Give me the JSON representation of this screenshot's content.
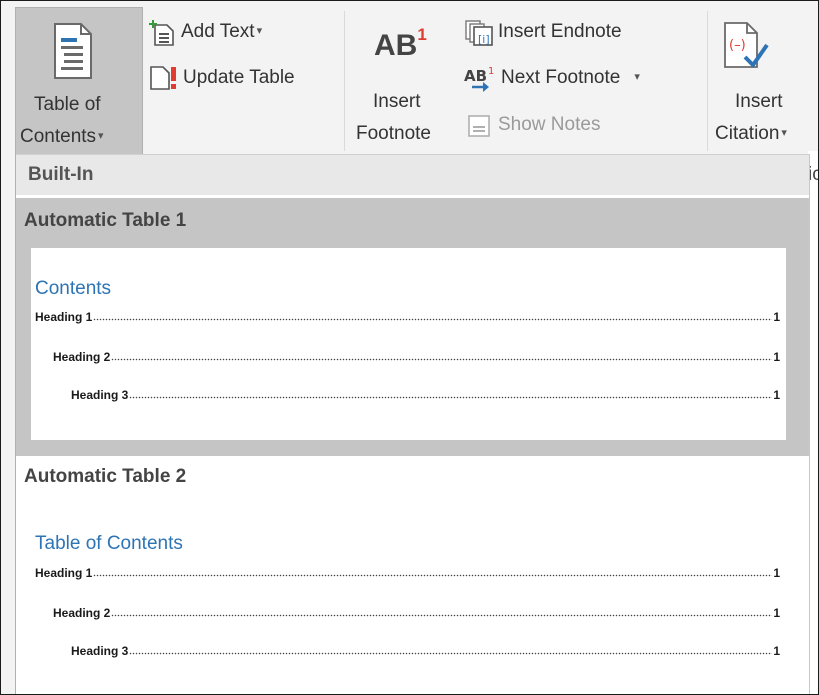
{
  "ribbon": {
    "toc_label_line1": "Table of",
    "toc_label_line2": "Contents",
    "add_text_label": "Add Text",
    "update_table_label": "Update Table",
    "ab_glyph": "AB",
    "ab_superscript": "1",
    "insert_footnote_line1": "Insert",
    "insert_footnote_line2": "Footnote",
    "insert_endnote_label": "Insert Endnote",
    "next_footnote_label": "Next Footnote",
    "show_notes_label": "Show Notes",
    "insert_citation_line1": "Insert",
    "insert_citation_line2": "Citation",
    "cut_off_text": "ic",
    "caret_glyph": "▾"
  },
  "gallery": {
    "section_header": "Built-In",
    "items": [
      {
        "title": "Automatic Table 1",
        "preview_title": "Contents",
        "entries": [
          {
            "text": "Heading 1",
            "page": "1"
          },
          {
            "text": "Heading 2",
            "page": "1"
          },
          {
            "text": "Heading 3",
            "page": "1"
          }
        ]
      },
      {
        "title": "Automatic Table 2",
        "preview_title": "Table of Contents",
        "entries": [
          {
            "text": "Heading 1",
            "page": "1"
          },
          {
            "text": "Heading 2",
            "page": "1"
          },
          {
            "text": "Heading 3",
            "page": "1"
          }
        ]
      }
    ]
  },
  "colors": {
    "accent_blue": "#2e74b5",
    "footnote_red": "#e03c31",
    "selected_bg": "#c5c5c5",
    "ribbon_bg": "#f3f3f3"
  },
  "icons": [
    "table-of-contents-icon",
    "add-text-icon",
    "update-table-icon",
    "insert-footnote-icon",
    "insert-endnote-icon",
    "next-footnote-icon",
    "show-notes-icon",
    "insert-citation-icon"
  ]
}
